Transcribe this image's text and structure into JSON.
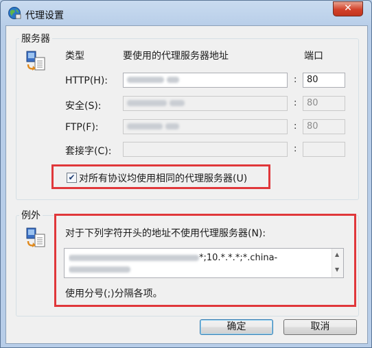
{
  "window": {
    "title": "代理设置",
    "close_label": "✕"
  },
  "servers": {
    "legend": "服务器",
    "col_type": "类型",
    "col_address": "要使用的代理服务器地址",
    "col_port": "端口",
    "rows": [
      {
        "label": "HTTP(H):",
        "port": "80",
        "enabled": true
      },
      {
        "label": "安全(S):",
        "port": "80",
        "enabled": false
      },
      {
        "label": "FTP(F):",
        "port": "80",
        "enabled": false
      },
      {
        "label": "套接字(C):",
        "port": "",
        "enabled": false
      }
    ],
    "same_proxy_label": "对所有协议均使用相同的代理服务器(U)",
    "same_proxy_checked": true
  },
  "exceptions": {
    "legend": "例外",
    "description": "对于下列字符开头的地址不使用代理服务器(N):",
    "value_visible": "*;10.*.*.*;*.china-",
    "hint": "使用分号(;)分隔各项。"
  },
  "buttons": {
    "ok": "确定",
    "cancel": "取消"
  },
  "colors": {
    "highlight": "#e0373a",
    "titlebar": "#c9dbf0"
  }
}
